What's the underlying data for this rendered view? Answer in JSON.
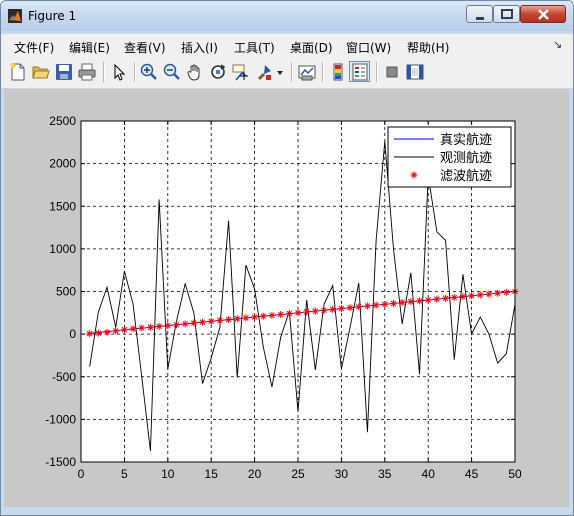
{
  "window": {
    "title": "Figure 1"
  },
  "menu": [
    "文件(F)",
    "编辑(E)",
    "查看(V)",
    "插入(I)",
    "工具(T)",
    "桌面(D)",
    "窗口(W)",
    "帮助(H)"
  ],
  "menu_overflow": "↘",
  "toolbar": [
    {
      "name": "new-figure-icon"
    },
    {
      "name": "open-file-icon"
    },
    {
      "name": "save-icon"
    },
    {
      "name": "print-icon"
    },
    {
      "name": "pointer-icon"
    },
    {
      "name": "zoom-in-icon"
    },
    {
      "name": "zoom-out-icon"
    },
    {
      "name": "pan-icon"
    },
    {
      "name": "rotate-icon"
    },
    {
      "name": "data-cursor-icon"
    },
    {
      "name": "brush-icon"
    },
    {
      "name": "link-plot-icon"
    },
    {
      "name": "colorbar-icon"
    },
    {
      "name": "legend-icon"
    },
    {
      "name": "hide-plot-tools-icon"
    },
    {
      "name": "show-plot-tools-icon"
    }
  ],
  "colors": {
    "axes_bg": "#ffffff",
    "figure_bg": "#c8c8c8",
    "true_track": "#0000ff",
    "observed_track": "#000000",
    "filtered_track": "#ff0000"
  },
  "chart_data": {
    "type": "line",
    "title": "",
    "xlabel": "",
    "ylabel": "",
    "xlim": [
      0,
      50
    ],
    "ylim": [
      -1500,
      2500
    ],
    "xticks": [
      0,
      5,
      10,
      15,
      20,
      25,
      30,
      35,
      40,
      45,
      50
    ],
    "yticks": [
      -1500,
      -1000,
      -500,
      0,
      500,
      1000,
      1500,
      2000,
      2500
    ],
    "grid": true,
    "legend_position": "top-right",
    "x": [
      1,
      2,
      3,
      4,
      5,
      6,
      7,
      8,
      9,
      10,
      11,
      12,
      13,
      14,
      15,
      16,
      17,
      18,
      19,
      20,
      21,
      22,
      23,
      24,
      25,
      26,
      27,
      28,
      29,
      30,
      31,
      32,
      33,
      34,
      35,
      36,
      37,
      38,
      39,
      40,
      41,
      42,
      43,
      44,
      45,
      46,
      47,
      48,
      49,
      50
    ],
    "series": [
      {
        "name": "真实航迹",
        "style": "line",
        "color": "#0000ff",
        "values": [
          10,
          20,
          30,
          40,
          50,
          60,
          70,
          80,
          90,
          100,
          110,
          120,
          130,
          140,
          150,
          160,
          170,
          180,
          190,
          200,
          210,
          220,
          230,
          240,
          250,
          260,
          270,
          280,
          290,
          300,
          310,
          320,
          330,
          340,
          350,
          360,
          370,
          380,
          390,
          400,
          410,
          420,
          430,
          440,
          450,
          460,
          470,
          480,
          490,
          500
        ]
      },
      {
        "name": "观测航迹",
        "style": "line",
        "color": "#000000",
        "values": [
          -380,
          260,
          550,
          80,
          740,
          350,
          -500,
          -1370,
          1580,
          -410,
          150,
          590,
          250,
          -580,
          -280,
          80,
          1330,
          -510,
          810,
          530,
          -150,
          -620,
          -40,
          270,
          -910,
          400,
          -420,
          350,
          570,
          -410,
          80,
          600,
          -1150,
          1100,
          2260,
          1000,
          120,
          720,
          -470,
          1860,
          1200,
          1100,
          -300,
          700,
          0,
          200,
          0,
          -340,
          -230,
          350
        ]
      },
      {
        "name": "滤波航迹",
        "style": "marker",
        "marker": "*",
        "color": "#ff0000",
        "values": [
          5,
          12,
          22,
          38,
          52,
          62,
          72,
          80,
          90,
          100,
          110,
          120,
          130,
          140,
          150,
          160,
          170,
          180,
          190,
          200,
          210,
          220,
          230,
          240,
          250,
          260,
          270,
          280,
          290,
          300,
          310,
          320,
          330,
          340,
          350,
          360,
          370,
          380,
          390,
          400,
          410,
          420,
          430,
          440,
          450,
          460,
          470,
          480,
          490,
          500
        ]
      }
    ]
  }
}
